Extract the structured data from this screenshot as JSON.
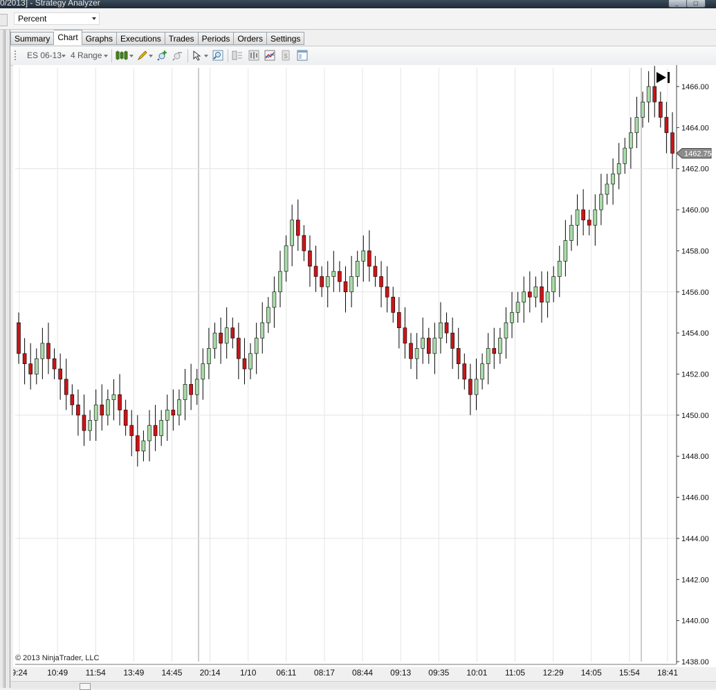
{
  "window": {
    "title": "0/2013] - Strategy Analyzer"
  },
  "selector": {
    "value": "Percent"
  },
  "tabs": [
    "Summary",
    "Chart",
    "Graphs",
    "Executions",
    "Trades",
    "Periods",
    "Orders",
    "Settings"
  ],
  "active_tab": "Chart",
  "toolbar": {
    "instrument": "ES 06-13",
    "period": "4 Range",
    "icons": [
      "bar-style-icon",
      "draw-pencil-icon",
      "zoom-in-icon",
      "zoom-out-icon",
      "cursor-pointer-icon",
      "magnifier-icon",
      "data-box-icon",
      "properties-icon",
      "indicators-icon",
      "strategies-icon",
      "window-layout-icon"
    ]
  },
  "chart_data": {
    "type": "candlestick",
    "instrument": "ES 06-13",
    "ylim": [
      1438.0,
      1466.75
    ],
    "yticks": [
      "1438.00",
      "1440.00",
      "1442.00",
      "1444.00",
      "1446.00",
      "1448.00",
      "1450.00",
      "1452.00",
      "1454.00",
      "1456.00",
      "1458.00",
      "1460.00",
      "1462.00",
      "1464.00",
      "1466.00"
    ],
    "xticks": [
      "9:24",
      "10:49",
      "11:54",
      "13:49",
      "14:45",
      "20:14",
      "1/10",
      "06:11",
      "08:17",
      "08:44",
      "09:13",
      "09:35",
      "10:01",
      "11:05",
      "12:29",
      "14:05",
      "15:54",
      "18:41"
    ],
    "last_price": "1462.75",
    "up_color": "#a9dba9",
    "down_color": "#c8161a",
    "copyright": "© 2013 NinjaTrader, LLC",
    "closes": [
      1453.0,
      1452.5,
      1452.0,
      1452.75,
      1453.5,
      1452.75,
      1452.25,
      1451.75,
      1451.0,
      1450.5,
      1450.0,
      1449.25,
      1449.75,
      1450.5,
      1450.0,
      1450.75,
      1451.0,
      1450.25,
      1449.5,
      1449.0,
      1448.25,
      1448.75,
      1449.5,
      1449.0,
      1449.75,
      1450.25,
      1450.0,
      1450.75,
      1451.5,
      1451.0,
      1451.75,
      1452.5,
      1453.25,
      1454.0,
      1453.5,
      1454.25,
      1453.75,
      1452.75,
      1452.25,
      1453.0,
      1453.75,
      1454.5,
      1455.25,
      1456.0,
      1457.0,
      1458.25,
      1459.5,
      1458.75,
      1458.0,
      1457.25,
      1456.75,
      1456.25,
      1456.75,
      1457.0,
      1456.5,
      1456.0,
      1456.75,
      1457.5,
      1458.0,
      1457.25,
      1456.75,
      1456.25,
      1455.75,
      1455.0,
      1454.25,
      1453.5,
      1452.75,
      1453.25,
      1453.75,
      1453.0,
      1453.75,
      1454.5,
      1454.0,
      1453.25,
      1452.5,
      1451.75,
      1451.0,
      1451.75,
      1452.5,
      1453.25,
      1453.0,
      1453.75,
      1454.5,
      1455.0,
      1455.5,
      1456.0,
      1455.75,
      1456.25,
      1455.5,
      1456.0,
      1456.75,
      1457.5,
      1458.5,
      1459.25,
      1460.0,
      1459.5,
      1459.25,
      1460.0,
      1460.75,
      1461.25,
      1461.75,
      1462.25,
      1463.0,
      1463.75,
      1464.5,
      1465.25,
      1466.0,
      1465.25,
      1464.5,
      1463.75,
      1462.75
    ]
  }
}
